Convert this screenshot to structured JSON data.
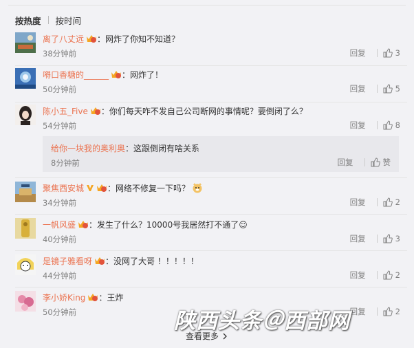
{
  "sort": {
    "hot": "按热度",
    "time": "按时间"
  },
  "comments": [
    {
      "user": "离了八丈远",
      "text": "网炸了你知不知道？",
      "time": "38分钟前",
      "reply": "回复",
      "likes": "3"
    },
    {
      "user": "嘚口香糖的______",
      "text": "网炸了！",
      "time": "50分钟前",
      "reply": "回复",
      "likes": "5"
    },
    {
      "user": "陈小五_Five",
      "text": "你们每天咋不发自己公司断网的事情呢？要倒闭了么？",
      "time": "54分钟前",
      "reply": "回复",
      "likes": "8",
      "sub": {
        "user": "给你一块我的奥利奥",
        "text": "这跟倒闭有啥关系",
        "time": "8分钟前",
        "reply": "回复",
        "likes": "赞"
      }
    },
    {
      "user": "聚焦西安城",
      "text": "网络不修复一下吗？",
      "time": "34分钟前",
      "reply": "回复",
      "likes": "2"
    },
    {
      "user": "一帆风盛",
      "text": "发生了什么？10000号我居然打不通了☺",
      "time": "40分钟前",
      "reply": "回复",
      "likes": "3"
    },
    {
      "user": "是镜子雅看呀",
      "text": "没网了大哥 ！！！！！",
      "time": "44分钟前",
      "reply": "回复",
      "likes": "2"
    },
    {
      "user": "李小娇King",
      "text": "王炸",
      "time": "50分钟前",
      "reply": "回复",
      "likes": "2"
    }
  ],
  "colon": "：",
  "more": "查看更多",
  "watermark": "陕西头条＠西部网",
  "colors": {
    "username": "#eb7350",
    "meta": "#808080",
    "background": "#f2f2f5"
  }
}
